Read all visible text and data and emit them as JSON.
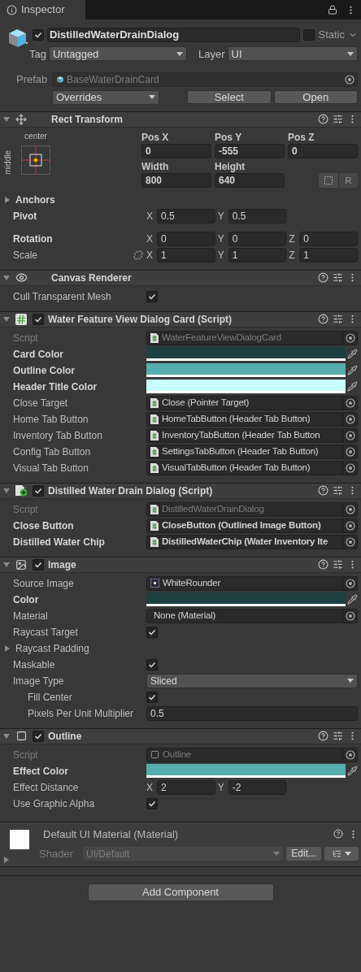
{
  "tab": {
    "label": "Inspector"
  },
  "object": {
    "name": "DistilledWaterDrainDialog",
    "active": true,
    "static_label": "Static",
    "static": false,
    "tag_label": "Tag",
    "tag": "Untagged",
    "layer_label": "Layer",
    "layer": "UI"
  },
  "prefab": {
    "label": "Prefab",
    "asset": "BaseWaterDrainCard",
    "overrides": "Overrides",
    "buttons": [
      "Select",
      "Open"
    ]
  },
  "components": [
    {
      "kind": "rect",
      "title": "Rect Transform",
      "expanded": true,
      "anchor_h": "center",
      "anchor_v": "middle",
      "position": [
        {
          "label": "Pos X",
          "value": "0"
        },
        {
          "label": "Pos Y",
          "value": "-555"
        },
        {
          "label": "Pos Z",
          "value": "0"
        }
      ],
      "size": [
        {
          "label": "Width",
          "value": "800"
        },
        {
          "label": "Height",
          "value": "640"
        }
      ],
      "raw_button": "R",
      "rows": [
        {
          "kind": "foldout",
          "label": "Anchors",
          "overridden": true,
          "expanded": false
        },
        {
          "kind": "vector",
          "label": "Pivot",
          "overridden": true,
          "fields": [
            {
              "axis": "X",
              "value": "0.5"
            },
            {
              "axis": "Y",
              "value": "0.5"
            }
          ]
        },
        {
          "kind": "vector",
          "label": "Rotation",
          "overridden": true,
          "fields": [
            {
              "axis": "X",
              "value": "0"
            },
            {
              "axis": "Y",
              "value": "0"
            },
            {
              "axis": "Z",
              "value": "0"
            }
          ]
        },
        {
          "kind": "vector",
          "label": "Scale",
          "overridden": false,
          "constrained": false,
          "fields": [
            {
              "axis": "X",
              "value": "1"
            },
            {
              "axis": "Y",
              "value": "1"
            },
            {
              "axis": "Z",
              "value": "1"
            }
          ]
        }
      ]
    },
    {
      "kind": "renderer",
      "title": "Canvas Renderer",
      "expanded": true,
      "rows": [
        {
          "kind": "checkbox",
          "label": "Cull Transparent Mesh",
          "overridden": false,
          "checked": true
        }
      ]
    },
    {
      "kind": "script",
      "title": "Water Feature View Dialog Card (Script)",
      "expanded": true,
      "enabled": true,
      "rows": [
        {
          "kind": "scriptref",
          "label": "Script",
          "overridden": false,
          "disabled": true,
          "value": "WaterFeatureViewDialogCard"
        },
        {
          "kind": "color",
          "label": "Card Color",
          "overridden": true,
          "color": "#1d3f40"
        },
        {
          "kind": "color",
          "label": "Outline Color",
          "overridden": true,
          "color": "#55adad"
        },
        {
          "kind": "color",
          "label": "Header Title Color",
          "overridden": true,
          "color": "#c8fdfd"
        },
        {
          "kind": "scriptref",
          "label": "Close Target",
          "overridden": false,
          "disabled": false,
          "value": "Close (Pointer Target)"
        },
        {
          "kind": "scriptref",
          "label": "Home Tab Button",
          "overridden": false,
          "disabled": false,
          "value": "HomeTabButton (Header Tab Button)"
        },
        {
          "kind": "scriptref",
          "label": "Inventory Tab Button",
          "overridden": false,
          "disabled": false,
          "value": "InventoryTabButton (Header Tab Button"
        },
        {
          "kind": "scriptref",
          "label": "Config Tab Button",
          "overridden": false,
          "disabled": false,
          "value": "SettingsTabButton (Header Tab Button)"
        },
        {
          "kind": "scriptref",
          "label": "Visual Tab Button",
          "overridden": false,
          "disabled": false,
          "value": "VisualTabButton (Header Tab Button)"
        }
      ]
    },
    {
      "kind": "behaviour",
      "title": "Distilled Water Drain Dialog (Script)",
      "expanded": true,
      "enabled": true,
      "rows": [
        {
          "kind": "scriptref",
          "label": "Script",
          "overridden": false,
          "disabled": true,
          "value": "DistilledWaterDrainDialog"
        },
        {
          "kind": "scriptref",
          "label": "Close Button",
          "overridden": true,
          "disabled": false,
          "value": "CloseButton (Outlined Image Button)"
        },
        {
          "kind": "scriptref",
          "label": "Distilled Water Chip",
          "overridden": true,
          "disabled": false,
          "value": "DistilledWaterChip (Water Inventory Ite"
        }
      ]
    },
    {
      "kind": "image",
      "title": "Image",
      "expanded": true,
      "enabled": true,
      "rows": [
        {
          "kind": "spriteref",
          "label": "Source Image",
          "overridden": false,
          "disabled": false,
          "value": "WhiteRounder"
        },
        {
          "kind": "color",
          "label": "Color",
          "overridden": true,
          "color": "#1d3f40"
        },
        {
          "kind": "assetref",
          "label": "Material",
          "overridden": false,
          "disabled": false,
          "value": "None (Material)"
        },
        {
          "kind": "checkbox",
          "label": "Raycast Target",
          "overridden": false,
          "checked": true
        },
        {
          "kind": "foldout",
          "label": "Raycast Padding",
          "overridden": false,
          "expanded": false
        },
        {
          "kind": "checkbox",
          "label": "Maskable",
          "overridden": false,
          "checked": true
        },
        {
          "kind": "dropdown",
          "label": "Image Type",
          "overridden": false,
          "value": "Sliced",
          "children": [
            {
              "kind": "checkbox",
              "label": "Fill Center",
              "overridden": false,
              "checked": true
            },
            {
              "kind": "number",
              "label": "Pixels Per Unit Multiplier",
              "overridden": false,
              "value": "0.5"
            }
          ]
        }
      ]
    },
    {
      "kind": "outline",
      "title": "Outline",
      "expanded": true,
      "enabled": true,
      "rows": [
        {
          "kind": "componentref",
          "label": "Script",
          "overridden": false,
          "disabled": true,
          "value": "Outline"
        },
        {
          "kind": "color",
          "label": "Effect Color",
          "overridden": true,
          "color": "#55adad"
        },
        {
          "kind": "vector",
          "label": "Effect Distance",
          "overridden": false,
          "fields": [
            {
              "axis": "X",
              "value": "2"
            },
            {
              "axis": "Y",
              "value": "-2"
            }
          ]
        },
        {
          "kind": "checkbox",
          "label": "Use Graphic Alpha",
          "overridden": false,
          "checked": true
        }
      ]
    }
  ],
  "material": {
    "title": "Default UI Material (Material)",
    "expanded": false,
    "shader_label": "Shader",
    "shader": "UI/Default",
    "edit_button": "Edit..."
  },
  "add_component": "Add Component"
}
